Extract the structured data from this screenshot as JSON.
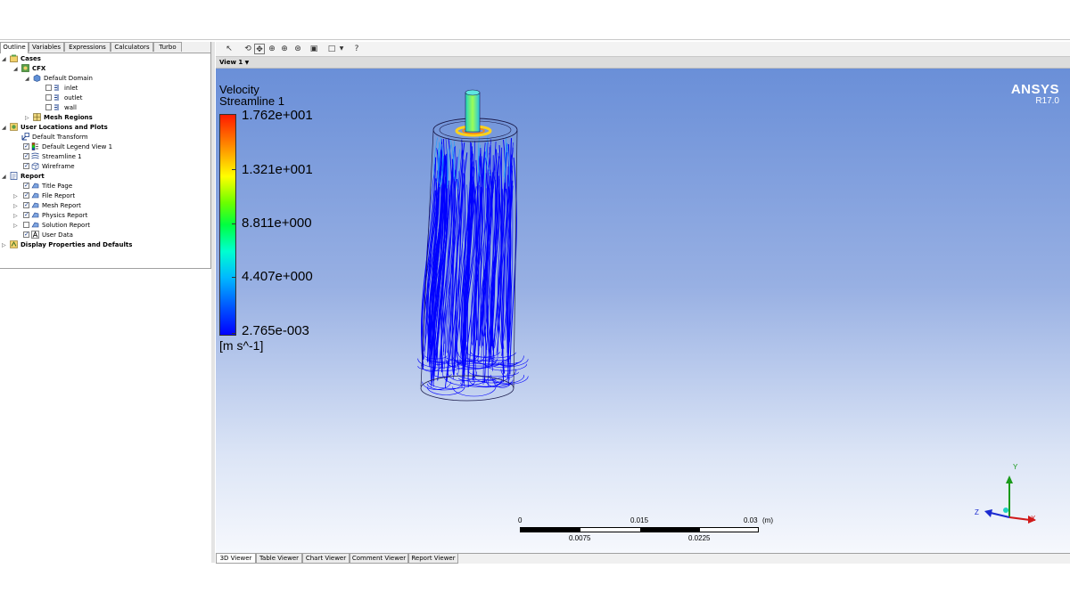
{
  "left_panel": {
    "tabs": [
      "Outline",
      "Variables",
      "Expressions",
      "Calculators",
      "Turbo"
    ],
    "tree": {
      "cases": "Cases",
      "cfx": "CFX",
      "default_domain": "Default Domain",
      "inlet": "inlet",
      "outlet": "outlet",
      "wall": "wall",
      "mesh_regions": "Mesh Regions",
      "user_locations": "User Locations and Plots",
      "default_transform": "Default Transform",
      "default_legend": "Default Legend View 1",
      "streamline": "Streamline 1",
      "wireframe": "Wireframe",
      "report": "Report",
      "title_page": "Title Page",
      "file_report": "File Report",
      "mesh_report": "Mesh Report",
      "physics_report": "Physics Report",
      "solution_report": "Solution Report",
      "user_data": "User Data",
      "display_properties": "Display Properties and Defaults"
    }
  },
  "toolbar": {
    "icons": [
      "pick-icon",
      "rotate-icon",
      "pan-icon",
      "zoom-icon",
      "zoom-box-icon",
      "zoom-fit-icon",
      "fit-view-icon",
      "viewport-layout-icon",
      "help-icon"
    ]
  },
  "viewer": {
    "view_selector": "View 1",
    "legend": {
      "variable": "Velocity",
      "plot_name": "Streamline 1",
      "values": [
        "1.762e+001",
        "1.321e+001",
        "8.811e+000",
        "4.407e+000",
        "2.765e-003"
      ],
      "units": "[m s^-1]"
    },
    "brand": {
      "name": "ANSYS",
      "version": "R17.0"
    },
    "scale": {
      "top_labels": [
        "0",
        "0.015",
        "0.03",
        "(m)"
      ],
      "bottom_labels": [
        "0.0075",
        "0.0225"
      ]
    },
    "triad": {
      "y": "Y",
      "z": "Z",
      "x": "X"
    },
    "colors": {
      "background_top": "#6a8fd8",
      "background_bottom": "#f6f8fd",
      "streamline": "#0000ff"
    }
  },
  "bottom_tabs": [
    "3D Viewer",
    "Table Viewer",
    "Chart Viewer",
    "Comment Viewer",
    "Report Viewer"
  ]
}
